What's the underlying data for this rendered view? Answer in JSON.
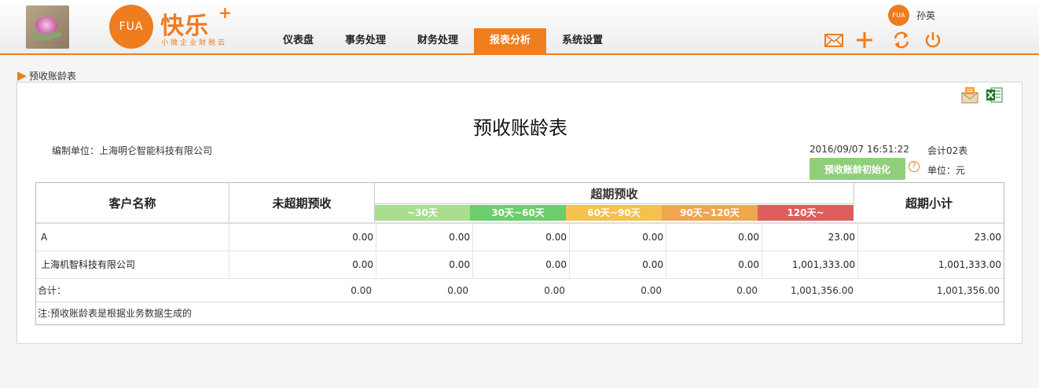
{
  "header": {
    "logo_circle_text": "FUA",
    "logo_text": "快乐",
    "logo_plus": "+",
    "logo_subtitle": "小微企业财税云",
    "nav": [
      "仪表盘",
      "事务处理",
      "财务处理",
      "报表分析",
      "系统设置"
    ],
    "active_nav": "报表分析",
    "avatar_text": "FUA",
    "user_name": "孙英",
    "icons": [
      "mail-icon",
      "plus-icon",
      "refresh-icon",
      "power-icon"
    ],
    "accent_color": "#ee7e1e"
  },
  "breadcrumb": {
    "label": "预收账龄表"
  },
  "report": {
    "title": "预收账龄表",
    "company": "编制单位：上海明仑智能科技有限公司",
    "datetime": "2016/09/07 16:51:22",
    "table_count": "会计02表",
    "init_button": "预收账龄初始化",
    "help": "?",
    "unit": "单位：元",
    "export_icons": [
      "email-export-icon",
      "excel-export-icon"
    ]
  },
  "table": {
    "headers": {
      "customer": "客户名称",
      "not_overdue": "未超期预收",
      "overdue": "超期预收",
      "subtotal": "超期小计"
    },
    "buckets": [
      {
        "label": "~30天",
        "color": "#a9dd8f"
      },
      {
        "label": "30天~60天",
        "color": "#6bcf6b"
      },
      {
        "label": "60天~90天",
        "color": "#f5c14d"
      },
      {
        "label": "90天~120天",
        "color": "#f0a64c"
      },
      {
        "label": "120天~",
        "color": "#e05d5d"
      }
    ],
    "rows": [
      {
        "name": "A",
        "values": [
          "0.00",
          "0.00",
          "0.00",
          "0.00",
          "0.00",
          "23.00",
          "23.00"
        ]
      },
      {
        "name": "上海机智科技有限公司",
        "values": [
          "0.00",
          "0.00",
          "0.00",
          "0.00",
          "0.00",
          "1,001,333.00",
          "1,001,333.00"
        ]
      }
    ],
    "total": {
      "label": "合计：",
      "values": [
        "0.00",
        "0.00",
        "0.00",
        "0.00",
        "0.00",
        "1,001,356.00",
        "1,001,356.00"
      ]
    },
    "note": "注:预收账龄表是根据业务数据生成的"
  }
}
